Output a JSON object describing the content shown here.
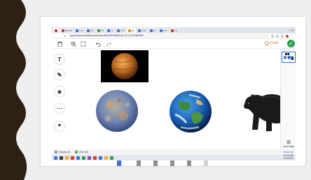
{
  "browser": {
    "tabs": [
      {
        "label": "",
        "fav": "red"
      },
      {
        "label": "My Bit",
        "fav": "red"
      },
      {
        "label": "Lea",
        "fav": "blue"
      },
      {
        "label": "Cla",
        "fav": "blue"
      },
      {
        "label": "l/B",
        "fav": "grn"
      },
      {
        "label": "Le",
        "fav": "blue"
      },
      {
        "label": "202",
        "fav": "blue"
      },
      {
        "label": "Ac",
        "fav": "org"
      },
      {
        "label": "Clas",
        "fav": "blue"
      },
      {
        "label": "Le",
        "fav": "blue"
      },
      {
        "label": "Lea",
        "fav": "blue"
      },
      {
        "label": "KK",
        "fav": "red"
      }
    ],
    "window_controls": "–  □  ✕",
    "url": "app.seesaw.me/#/item/new/class.69f0120f-9668-4eb1-a172-3224f5e6f96f"
  },
  "toolbar": {
    "trash_icon": "trash-icon",
    "zoom_icon": "zoom-in-icon",
    "crop_icon": "crop-icon",
    "undo_icon": "undo-icon",
    "redo_icon": "redo-icon",
    "draft_label": "Draft",
    "check_icon": "check-icon"
  },
  "left_tools": [
    {
      "name": "text-tool",
      "glyph": "T"
    },
    {
      "name": "pen-tool",
      "glyph": "✎"
    },
    {
      "name": "camera-tool",
      "glyph": "◙"
    },
    {
      "name": "more-tool",
      "glyph": "⋯"
    },
    {
      "name": "quote-tool",
      "glyph": "❞"
    }
  ],
  "right_panel": {
    "add_page_label": "Add Page",
    "add_page_icon": "add-page-icon"
  },
  "downloads": [
    {
      "label": "images (8)"
    },
    {
      "label": "valsh (3)"
    }
  ],
  "downloads_show_all": "Show all",
  "tray": {
    "time": "10:09 AM",
    "date": "2/1/2021"
  },
  "colors": {
    "accent": "#1a73e8",
    "draft": "#d87a3a",
    "done": "#2e9e4c",
    "frame_edge": "#2e2113"
  }
}
